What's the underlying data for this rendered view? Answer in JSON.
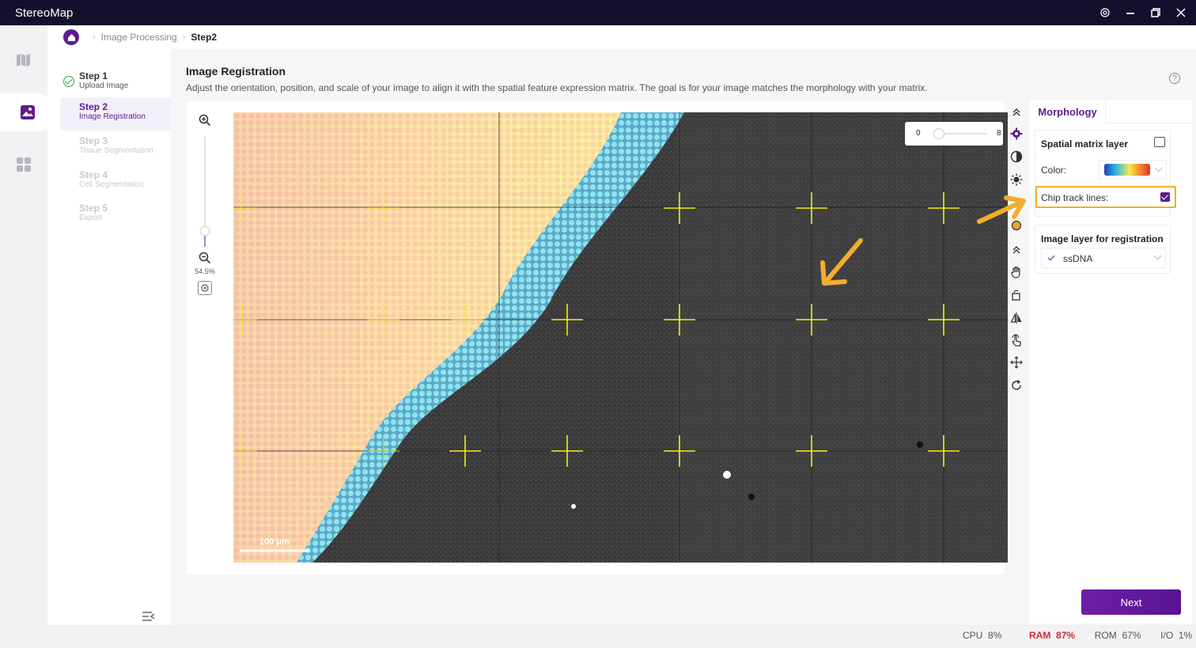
{
  "app": {
    "title": "StereoMap"
  },
  "breadcrumb": {
    "items": [
      "Image Processing",
      "Step2"
    ]
  },
  "steps": [
    {
      "title": "Step 1",
      "subtitle": "Upload Image",
      "state": "done"
    },
    {
      "title": "Step 2",
      "subtitle": "Image Registration",
      "state": "active"
    },
    {
      "title": "Step 3",
      "subtitle": "Tissue Segmentation",
      "state": "disabled"
    },
    {
      "title": "Step 4",
      "subtitle": "Cell Segmentation",
      "state": "disabled"
    },
    {
      "title": "Step 5",
      "subtitle": "Export",
      "state": "disabled"
    }
  ],
  "main": {
    "title": "Image Registration",
    "description": "Adjust the orientation, position, and scale of your image to align it with the spatial feature expression matrix. The goal is for your image matches the morphology with your matrix."
  },
  "viewer": {
    "zoom_percent": "54.5%",
    "zoom_level": 0.14,
    "scale_bar_label": "100 μm",
    "opacity_min": "0",
    "opacity_max": "8",
    "opacity_value": 0
  },
  "right_panel": {
    "tab_label": "Morphology",
    "spatial_section_title": "Spatial matrix layer",
    "color_label": "Color:",
    "chip_track_label": "Chip track lines:",
    "chip_track_checked": true,
    "image_section_title": "Image layer for registration",
    "image_layer_value": "ssDNA"
  },
  "actions": {
    "next_label": "Next"
  },
  "status": {
    "cpu_label": "CPU",
    "cpu_value": "8%",
    "ram_label": "RAM",
    "ram_value": "87%",
    "rom_label": "ROM",
    "rom_value": "67%",
    "io_label": "I/O",
    "io_value": "1%"
  },
  "colors": {
    "brand": "#5b1d8f",
    "titlebar": "#12102d",
    "highlight": "#f3ad2d",
    "ram_alert": "#e0252a",
    "crosshair": "#f2ee1a"
  },
  "icons": {
    "rail": [
      "map-icon",
      "image-icon",
      "apps-icon"
    ],
    "tools": [
      "collapse-up-icon",
      "opacity-icon",
      "contrast-icon",
      "brightness-icon",
      "color-drop-icon",
      "collapse-up-icon",
      "pan-hand-icon",
      "rotate-90-icon",
      "flip-icon",
      "point-select-icon",
      "move-icon",
      "reset-icon"
    ]
  }
}
